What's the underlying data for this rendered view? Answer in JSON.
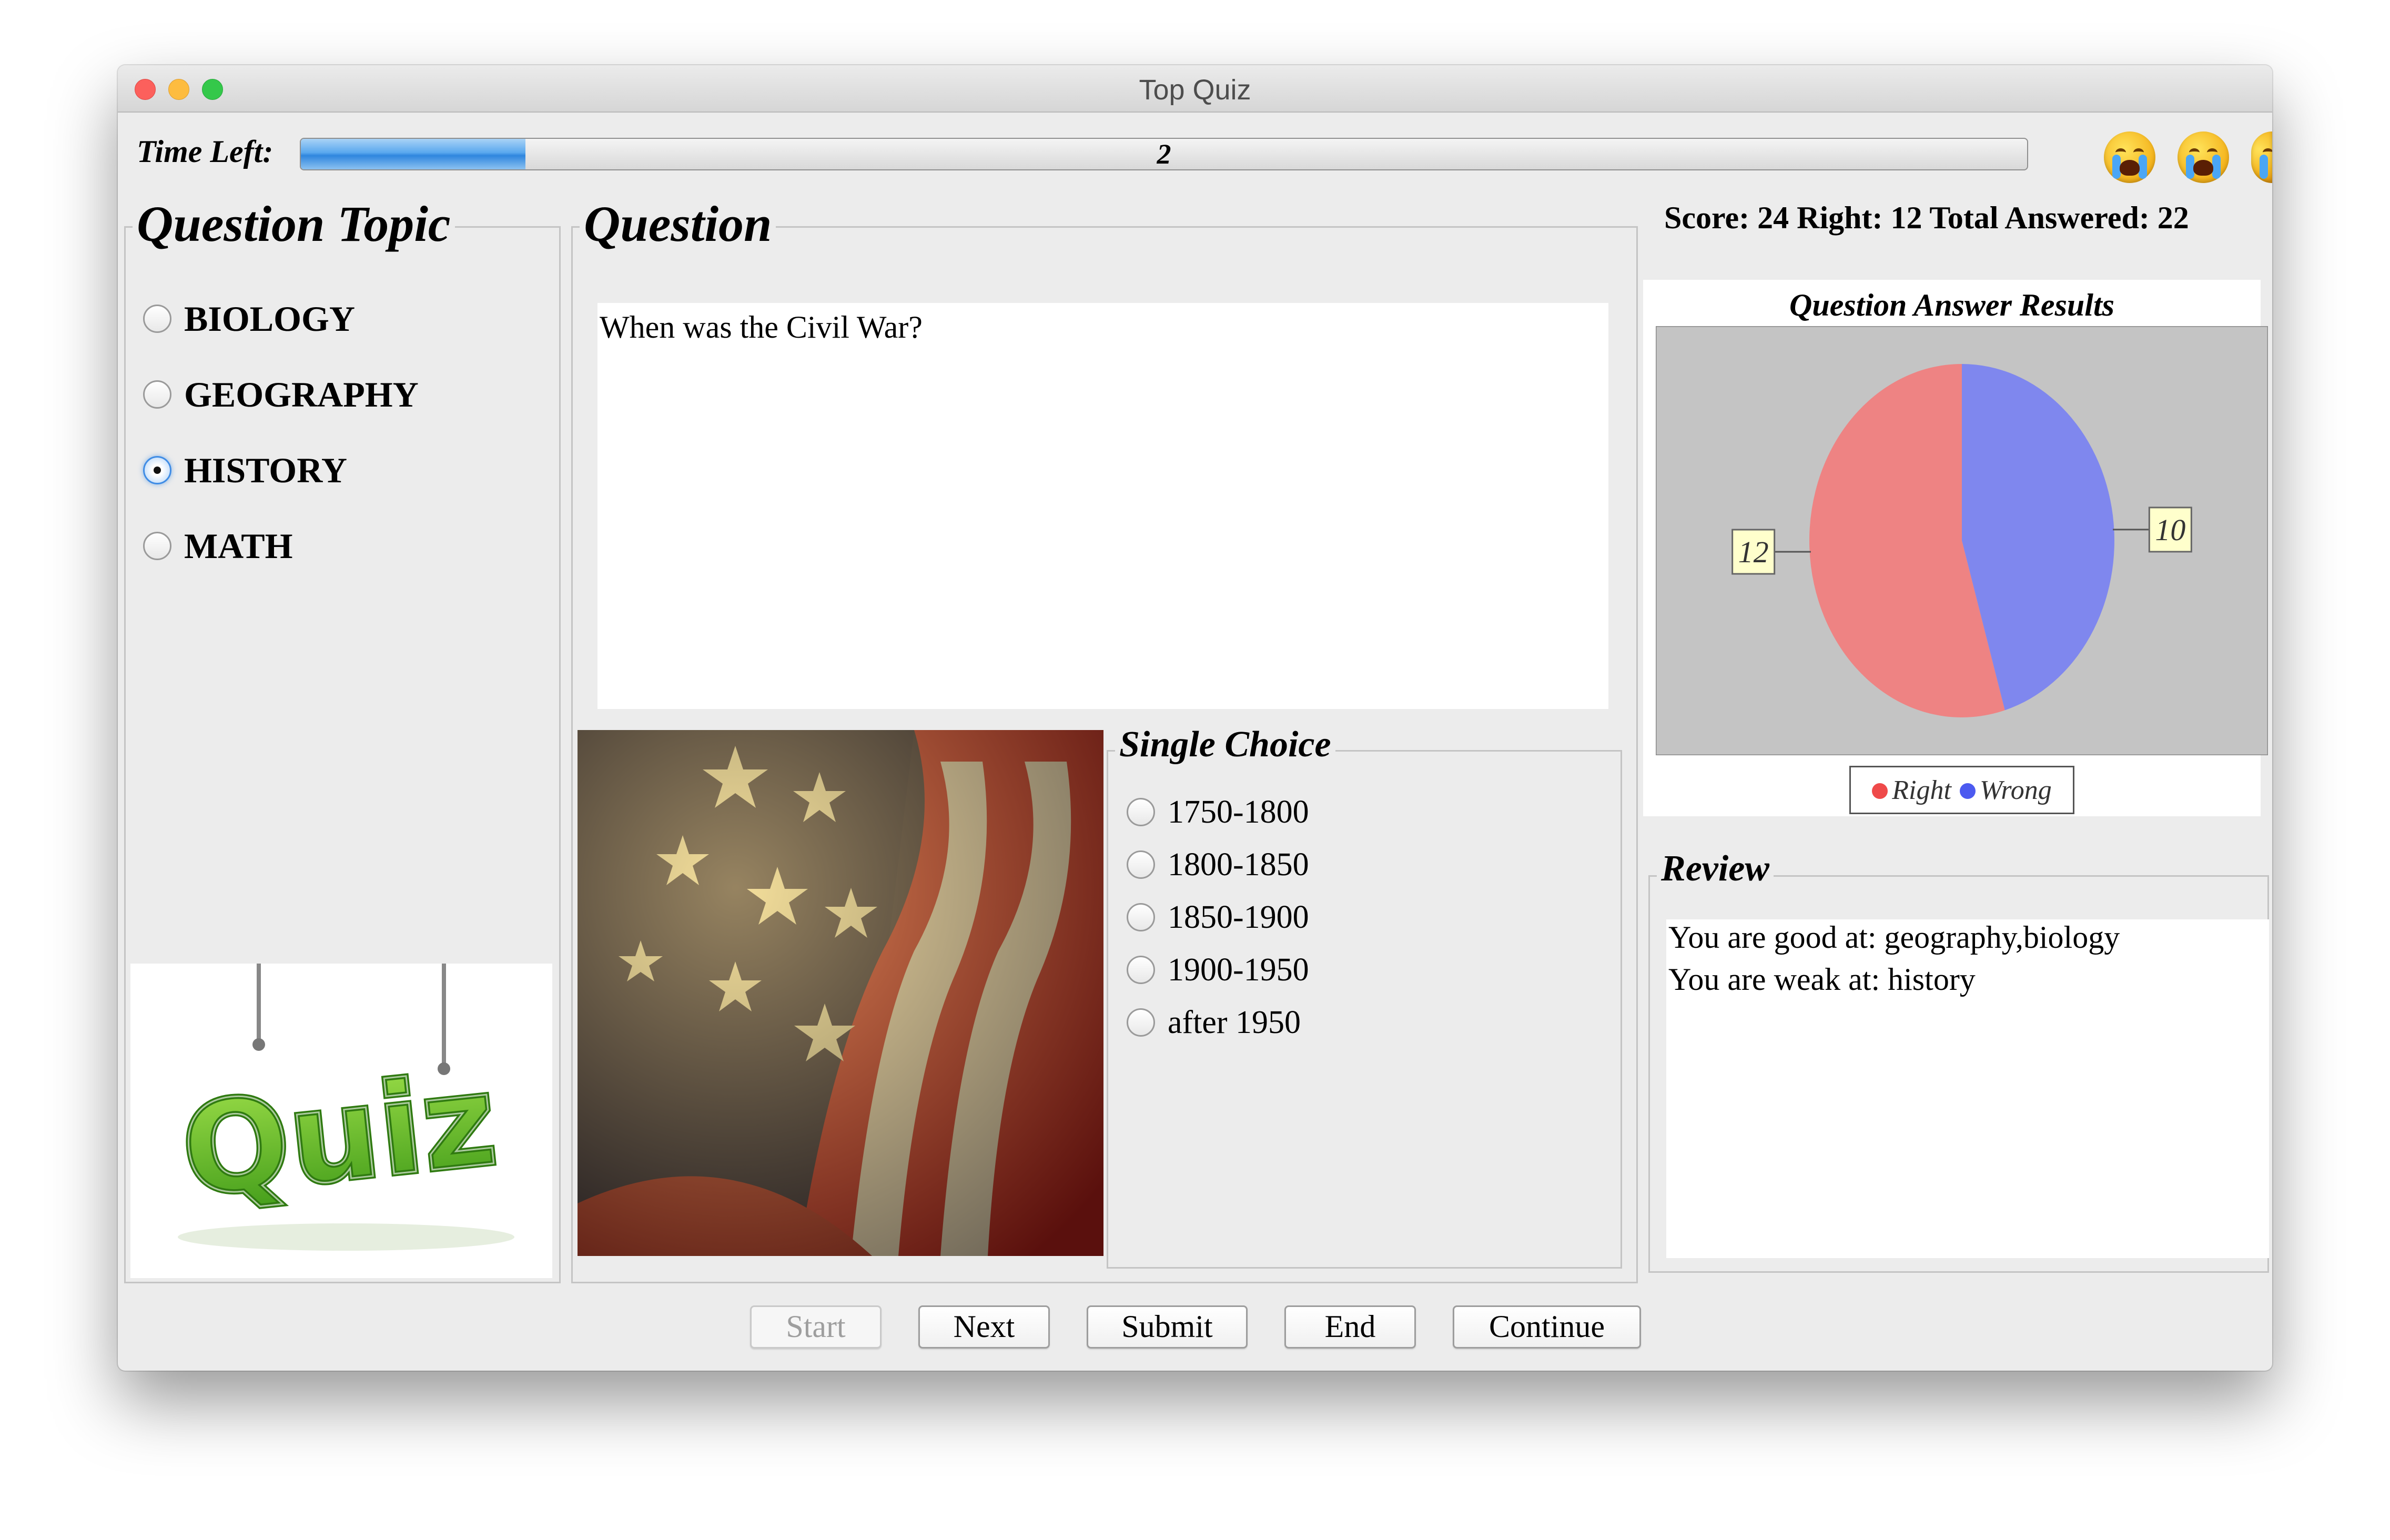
{
  "window": {
    "title": "Top Quiz"
  },
  "timer": {
    "label": "Time Left:",
    "value": "2",
    "progress_fraction": 0.13
  },
  "topics": {
    "title": "Question Topic",
    "items": [
      {
        "label": "BIOLOGY",
        "selected": false
      },
      {
        "label": "GEOGRAPHY",
        "selected": false
      },
      {
        "label": "HISTORY",
        "selected": true
      },
      {
        "label": "MATH",
        "selected": false
      }
    ]
  },
  "logo": {
    "text": "Quiz"
  },
  "question": {
    "title": "Question",
    "text": "When was the Civil War?"
  },
  "choices": {
    "title": "Single Choice",
    "items": [
      "1750-1800",
      "1800-1850",
      "1850-1900",
      "1900-1950",
      "after 1950"
    ]
  },
  "score": {
    "text": "Score: 24  Right: 12  Total Answered: 22"
  },
  "chart_data": {
    "type": "pie",
    "title": "Question Answer Results",
    "series": [
      {
        "name": "Right",
        "value": 12,
        "color": "#f08080"
      },
      {
        "name": "Wrong",
        "value": 10,
        "color": "#7b84f0"
      }
    ],
    "legend_placement": "bottom"
  },
  "review": {
    "title": "Review",
    "lines": [
      "You are good at: geography,biology",
      "You are weak at: history"
    ]
  },
  "buttons": {
    "start": "Start",
    "next": "Next",
    "submit": "Submit",
    "end": "End",
    "continue": "Continue"
  },
  "colors": {
    "progress_fill": "#5aa8ee",
    "right_slice": "#f08080",
    "wrong_slice": "#7b84f0",
    "plot_background": "#c4c4c4"
  }
}
